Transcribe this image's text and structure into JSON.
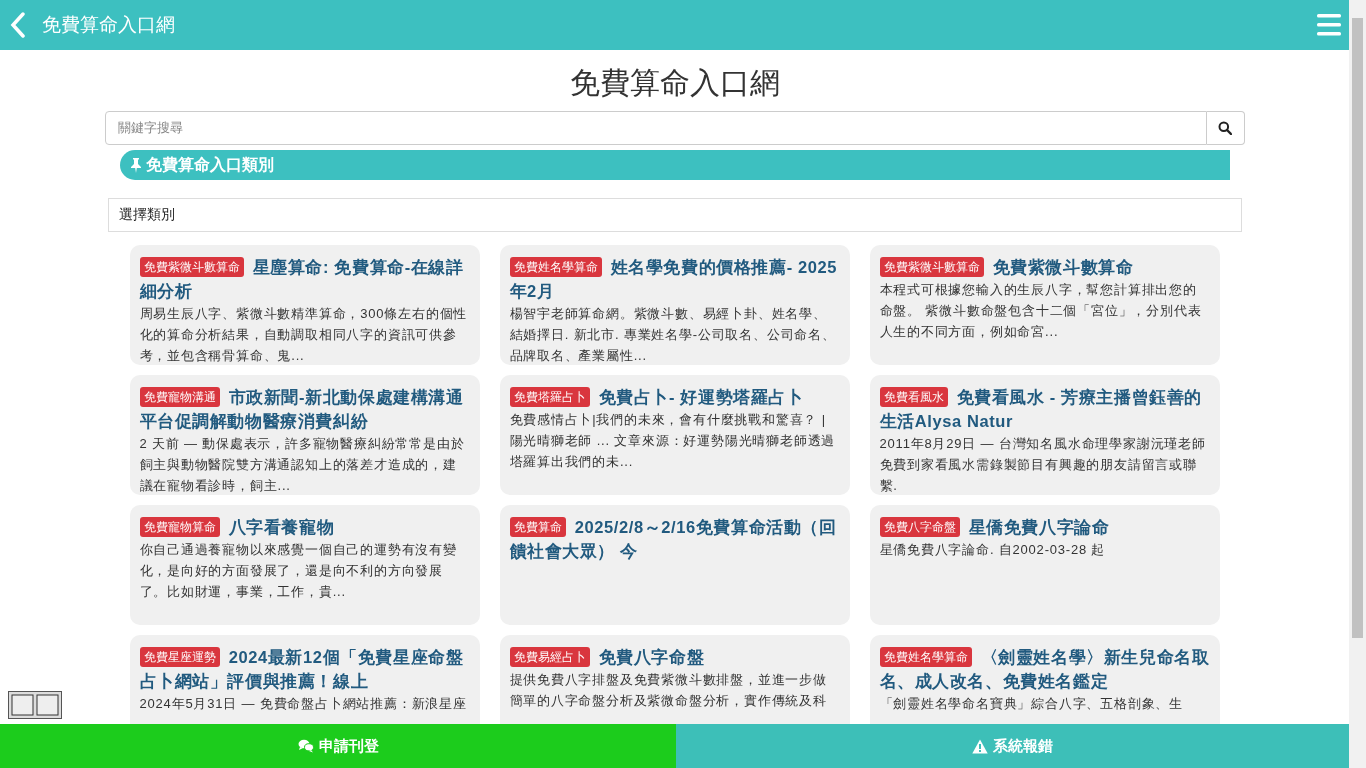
{
  "header": {
    "title": "免費算命入口網"
  },
  "heading": "免費算命入口網",
  "search": {
    "placeholder": "關鍵字搜尋"
  },
  "section": {
    "title": "免費算命入口類別"
  },
  "category_select": {
    "label": "選擇類別"
  },
  "cards": [
    {
      "tag": "免費紫微斗數算命",
      "title": "星塵算命: 免費算命-在線詳細分析",
      "description": "周易生辰八字、紫微斗數精準算命，300條左右的個性化的算命分析結果，自動調取相同八字的資訊可供參考，並包含稱骨算命、鬼..."
    },
    {
      "tag": "免費姓名學算命",
      "title": "姓名學免費的價格推薦- 2025年2月",
      "description": "楊智宇老師算命網。紫微斗數、易經卜卦、姓名學、結婚擇日. 新北市. 專業姓名學-公司取名、公司命名、品牌取名、產業屬性..."
    },
    {
      "tag": "免費紫微斗數算命",
      "title": "免費紫微斗數算命",
      "description": "本程式可根據您輸入的生辰八字，幫您計算排出您的命盤。 紫微斗數命盤包含十二個「宮位」，分別代表人生的不同方面，例如命宮..."
    },
    {
      "tag": "免費寵物溝通",
      "title": "市政新聞-新北動保處建構溝通平台促調解動物醫療消費糾紛",
      "description": "2 天前 — 動保處表示，許多寵物醫療糾紛常常是由於飼主與動物醫院雙方溝通認知上的落差才造成的，建議在寵物看診時，飼主..."
    },
    {
      "tag": "免費塔羅占卜",
      "title": "免費占卜- 好運勢塔羅占卜",
      "description": "免費感情占卜|我們的未來，會有什麼挑戰和驚喜？ | 陽光晴獅老師 ... 文章來源：好運勢陽光晴獅老師透過塔羅算出我們的未..."
    },
    {
      "tag": "免費看風水",
      "title": "免費看風水 - 芳療主播曾鈺善的生活Alysa Natur",
      "description": "2011年8月29日 — 台灣知名風水命理學家謝沅瑾老師免費到家看風水需錄製節目有興趣的朋友請留言或聯繫."
    },
    {
      "tag": "免費寵物算命",
      "title": "八字看養寵物",
      "description": "你自己通過養寵物以來感覺一個自己的運勢有沒有變化，是向好的方面發展了，還是向不利的方向發展了。比如財運，事業，工作，貴..."
    },
    {
      "tag": "免費算命",
      "title": "2025/2/8～2/16免費算命活動（回饋社會大眾） 今"
    },
    {
      "tag": "免費八字命盤",
      "title": "星僑免費八字論命",
      "description": "星僑免費八字論命. 自2002-03-28 起"
    },
    {
      "tag": "免費星座運勢",
      "title": "2024最新12個「免費星座命盤占卜網站」評價與推薦！線上",
      "description": "2024年5月31日 — 免費命盤占卜網站推薦：新浪星座"
    },
    {
      "tag": "免費易經占卜",
      "title": "免費八字命盤",
      "description": "提供免費八字排盤及免費紫微斗數排盤，並進一步做簡單的八字命盤分析及紫微命盤分析，實作傳統及科"
    },
    {
      "tag": "免費姓名學算命",
      "title": "〈劍靈姓名學〉新生兒命名取名、成人改名、免費姓名鑑定",
      "description": "「劍靈姓名學命名寶典」綜合八字、五格剖象、生"
    }
  ],
  "footer_buttons": [
    {
      "label": "申請刊登",
      "kind": "apply"
    },
    {
      "label": "系統報錯",
      "kind": "report"
    }
  ]
}
